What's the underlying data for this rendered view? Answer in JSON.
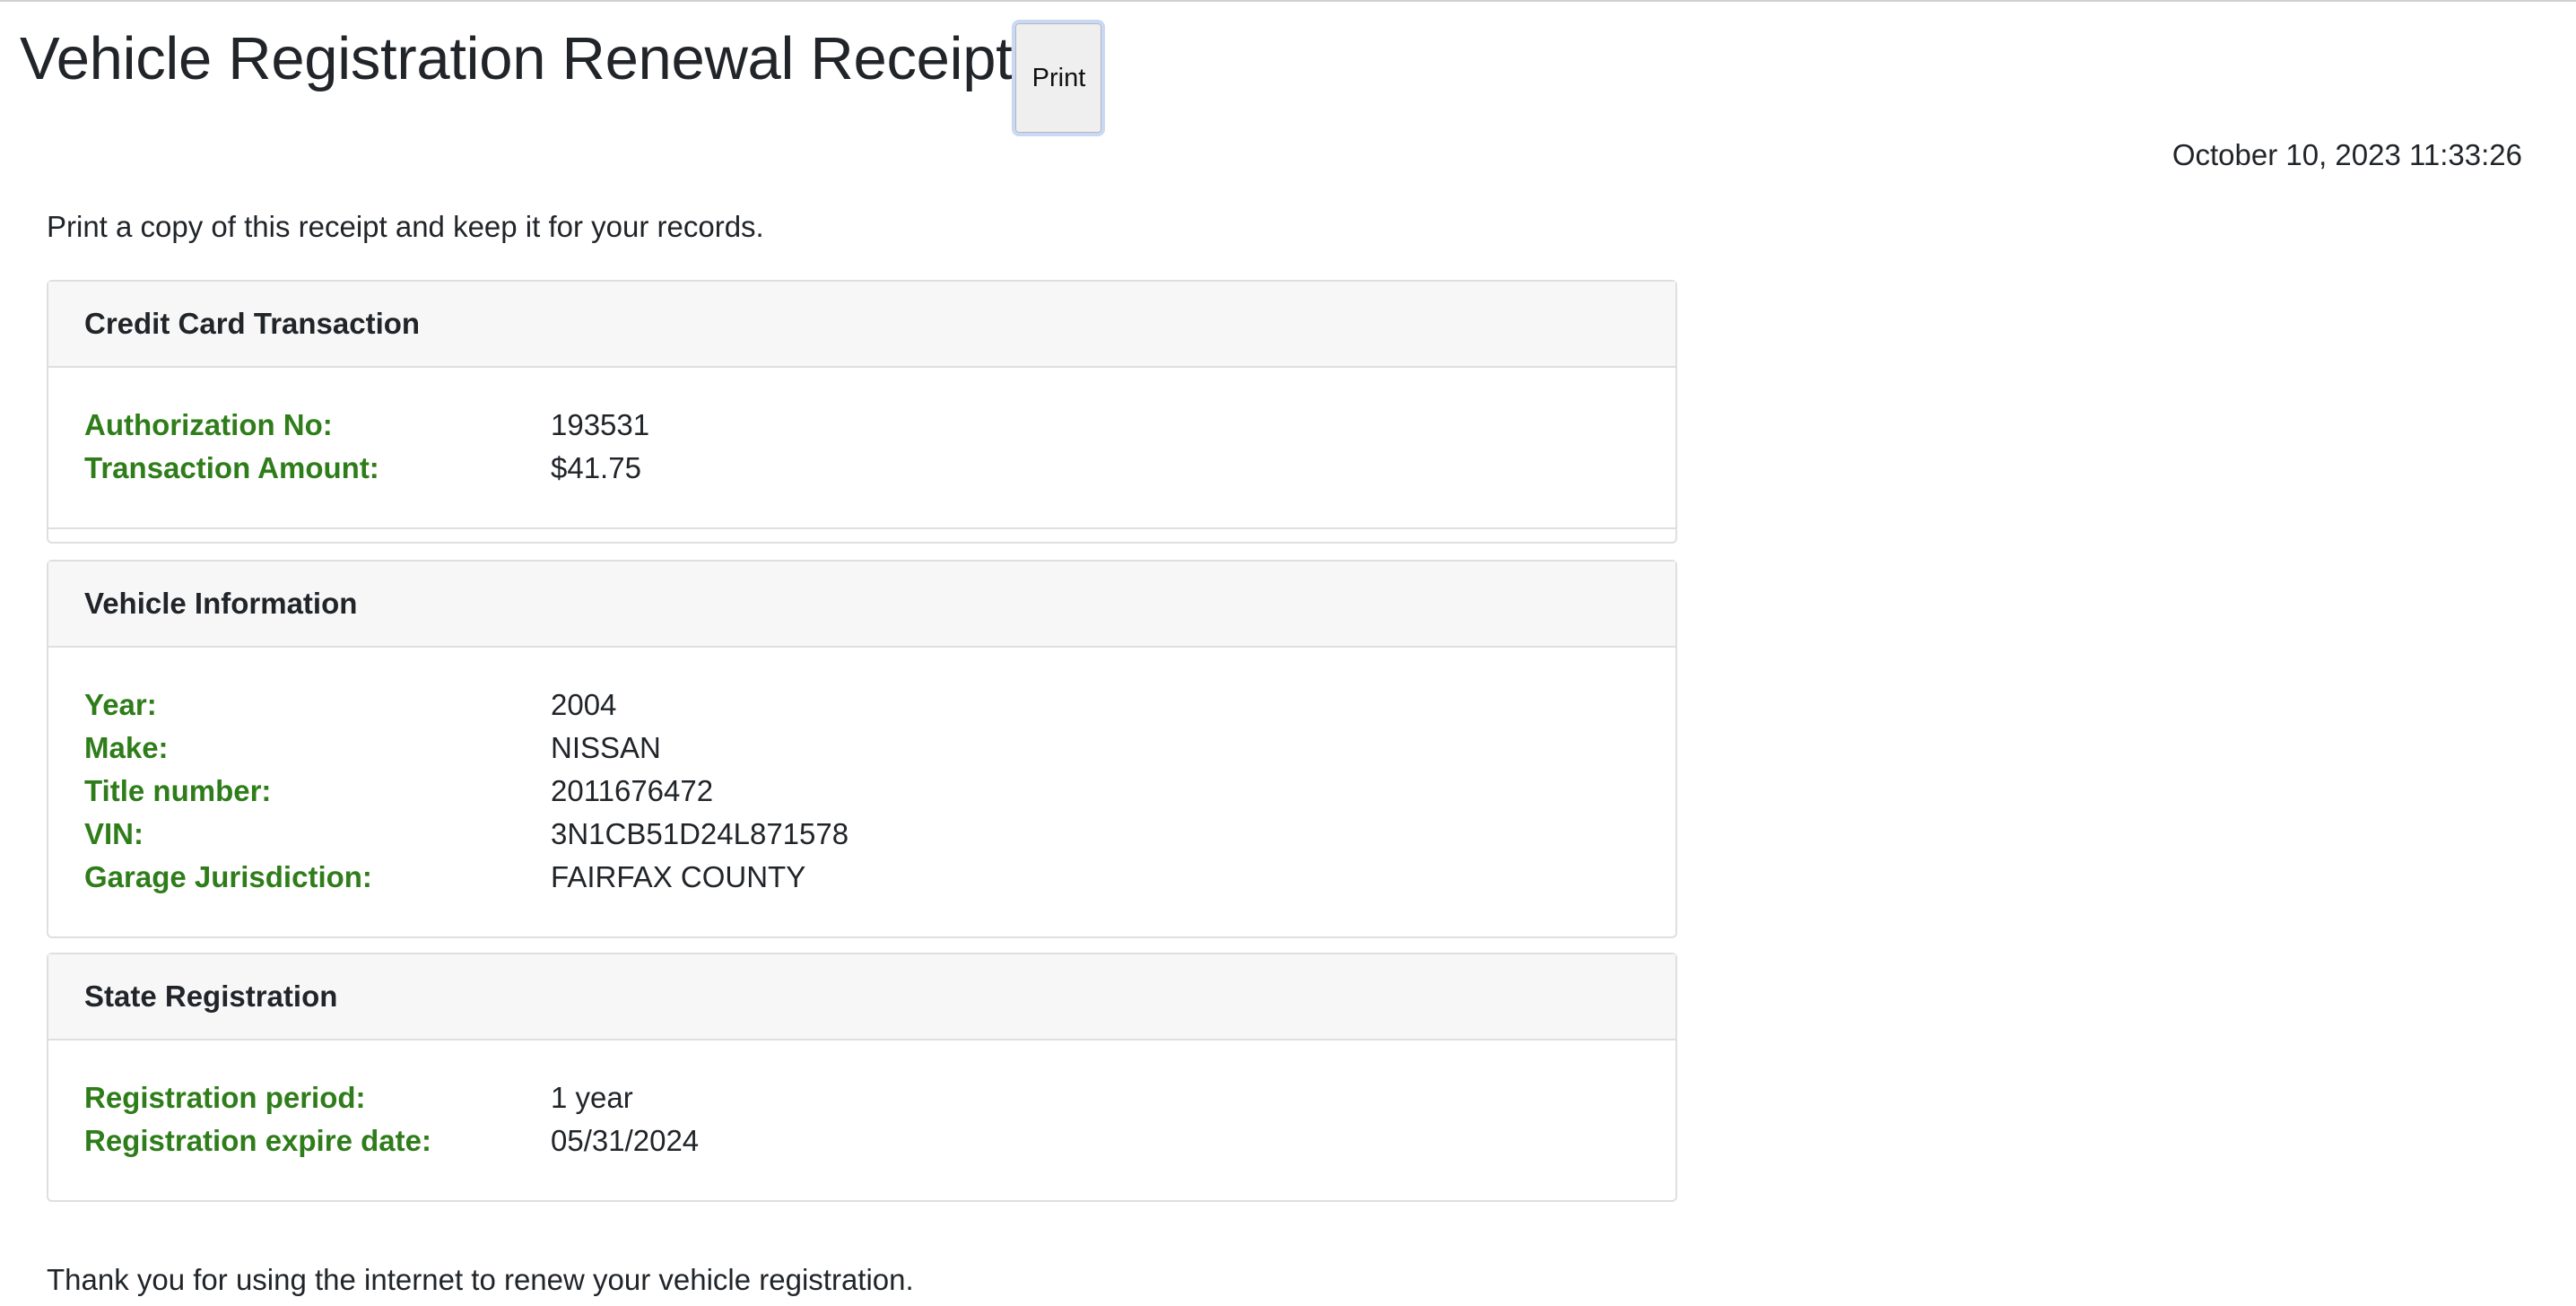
{
  "page": {
    "title": "Vehicle Registration Renewal Receipt",
    "print_label": "Print",
    "timestamp": "October 10, 2023 11:33:26",
    "intro": "Print a copy of this receipt and keep it for your records.",
    "closing": "Thank you for using the internet to renew your vehicle registration."
  },
  "credit_card": {
    "heading": "Credit Card Transaction",
    "rows": [
      {
        "label": "Authorization No:",
        "value": "193531"
      },
      {
        "label": "Transaction Amount:",
        "value": "$41.75"
      }
    ]
  },
  "vehicle": {
    "heading": "Vehicle Information",
    "rows": [
      {
        "label": "Year:",
        "value": "2004"
      },
      {
        "label": "Make:",
        "value": "NISSAN"
      },
      {
        "label": "Title number:",
        "value": "2011676472"
      },
      {
        "label": "VIN:",
        "value": "3N1CB51D24L871578"
      },
      {
        "label": "Garage Jurisdiction:",
        "value": "FAIRFAX COUNTY"
      }
    ]
  },
  "state_registration": {
    "heading": "State Registration",
    "rows": [
      {
        "label": "Registration period:",
        "value": "1 year"
      },
      {
        "label": "Registration expire date:",
        "value": "05/31/2024"
      }
    ]
  },
  "colors": {
    "label_green": "#2f7d1a",
    "header_bg": "#f7f7f7",
    "border": "#dfdfdf"
  }
}
